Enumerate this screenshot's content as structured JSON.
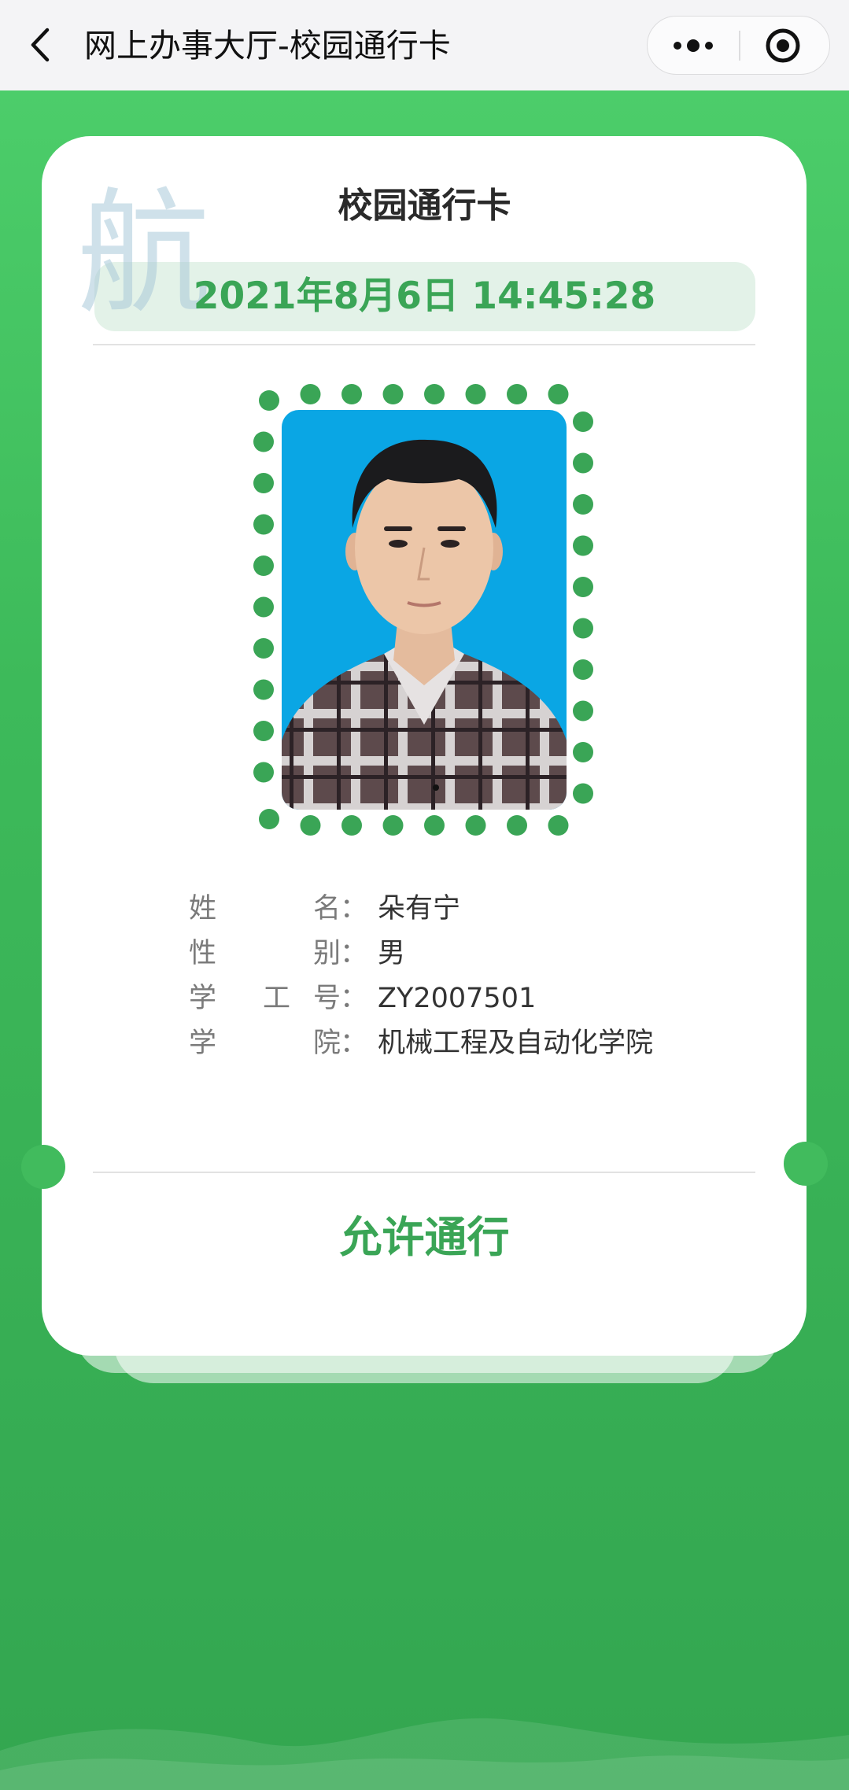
{
  "nav": {
    "title": "网上办事大厅-校园通行卡",
    "back_icon": "chevron-left-icon",
    "more_icon": "more-dots-icon",
    "close_icon": "target-circle-icon"
  },
  "card": {
    "watermark_char": "航",
    "title": "校园通行卡",
    "datetime": "2021年8月6日 14:45:28",
    "info": [
      {
        "label_chars": [
          "姓",
          "名"
        ],
        "value": "朵有宁"
      },
      {
        "label_chars": [
          "性",
          "别"
        ],
        "value": "男"
      },
      {
        "label_chars": [
          "学",
          "工",
          "号"
        ],
        "value": "ZY2007501"
      },
      {
        "label_chars": [
          "学",
          "院"
        ],
        "value": "机械工程及自动化学院"
      }
    ],
    "colon": "：",
    "status": "允许通行"
  },
  "colors": {
    "brand_green": "#3aa556",
    "background_green": "#44c462",
    "photo_background": "#0aa6e4"
  }
}
